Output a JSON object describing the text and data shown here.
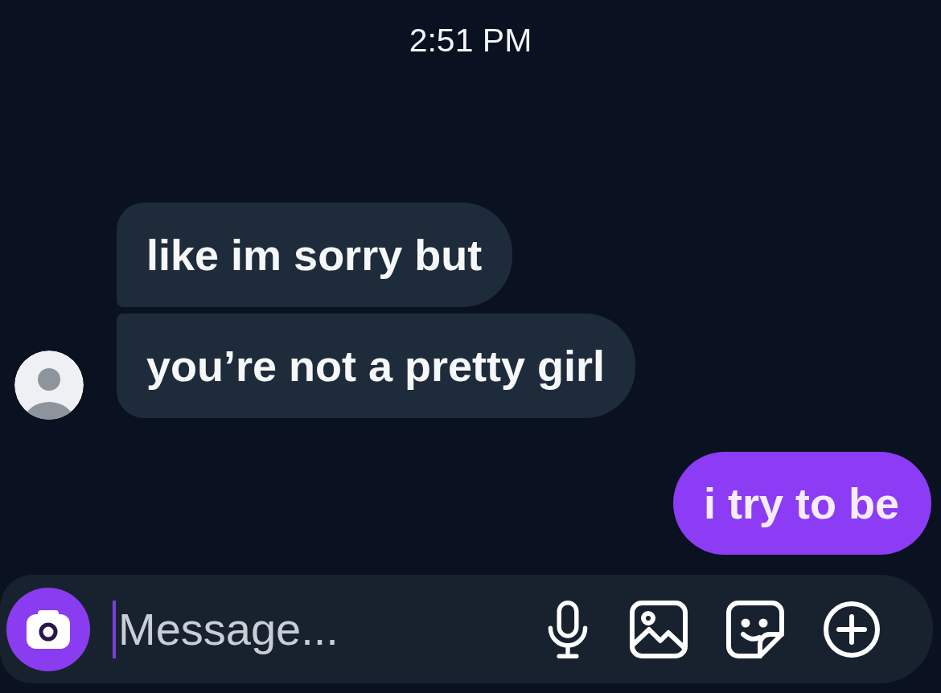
{
  "status": {
    "time": "2:51 PM"
  },
  "messages": [
    {
      "kind": "received",
      "text": "like im sorry but",
      "avatar": false
    },
    {
      "kind": "received",
      "text": "you’re not a pretty girl",
      "avatar": true
    },
    {
      "kind": "sent",
      "text": "i try to be"
    }
  ],
  "composer": {
    "placeholder": "Message...",
    "focused": true
  }
}
